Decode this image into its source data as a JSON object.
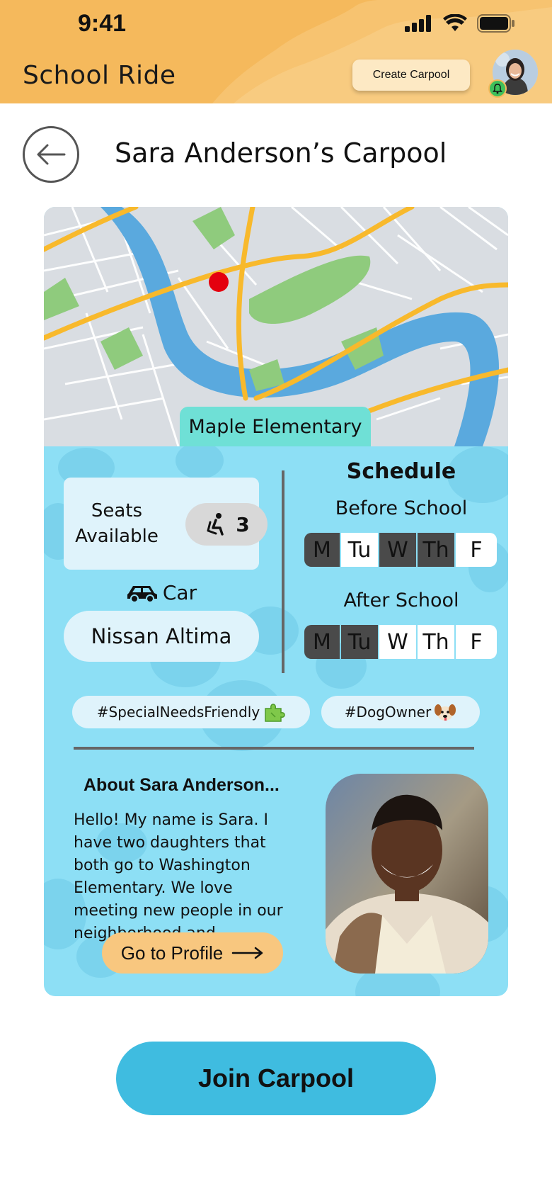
{
  "status_bar": {
    "time": "9:41"
  },
  "header": {
    "app_title": "School Ride",
    "create_button": "Create Carpool",
    "colors": {
      "header_bg": "#f5b95c",
      "notification": "#3fbf5a"
    }
  },
  "page": {
    "title": "Sara Anderson’s Carpool"
  },
  "map": {
    "school_name": "Maple Elementary",
    "pin_color": "#e4000f"
  },
  "seats": {
    "label_line1": "Seats",
    "label_line2": "Available",
    "count": "3",
    "icon": "seat-icon"
  },
  "car": {
    "label": "Car",
    "model": "Nissan Altima",
    "icon": "car-icon"
  },
  "schedule": {
    "title": "Schedule",
    "before": {
      "label": "Before School",
      "days": [
        {
          "day": "M",
          "active": true
        },
        {
          "day": "Tu",
          "active": false
        },
        {
          "day": "W",
          "active": true
        },
        {
          "day": "Th",
          "active": true
        },
        {
          "day": "F",
          "active": false
        }
      ]
    },
    "after": {
      "label": "After School",
      "days": [
        {
          "day": "M",
          "active": true
        },
        {
          "day": "Tu",
          "active": true
        },
        {
          "day": "W",
          "active": false
        },
        {
          "day": "Th",
          "active": false
        },
        {
          "day": "F",
          "active": false
        }
      ]
    }
  },
  "tags": [
    {
      "text": "#SpecialNeedsFriendly",
      "icon": "puzzle-icon"
    },
    {
      "text": "#DogOwner",
      "icon": "dog-icon"
    }
  ],
  "about": {
    "title": "About Sara Anderson...",
    "text": "Hello! My name is Sara. I have two daughters that both go to Washington Elementary. We love meeting new people in our neighborhood and...",
    "profile_button": "Go to Profile"
  },
  "join_button": "Join Carpool",
  "colors": {
    "card_bg": "#8ddff5",
    "join_bg": "#3fbce0",
    "profile_btn": "#f8c77f",
    "school_tag": "#6fe0d6"
  }
}
